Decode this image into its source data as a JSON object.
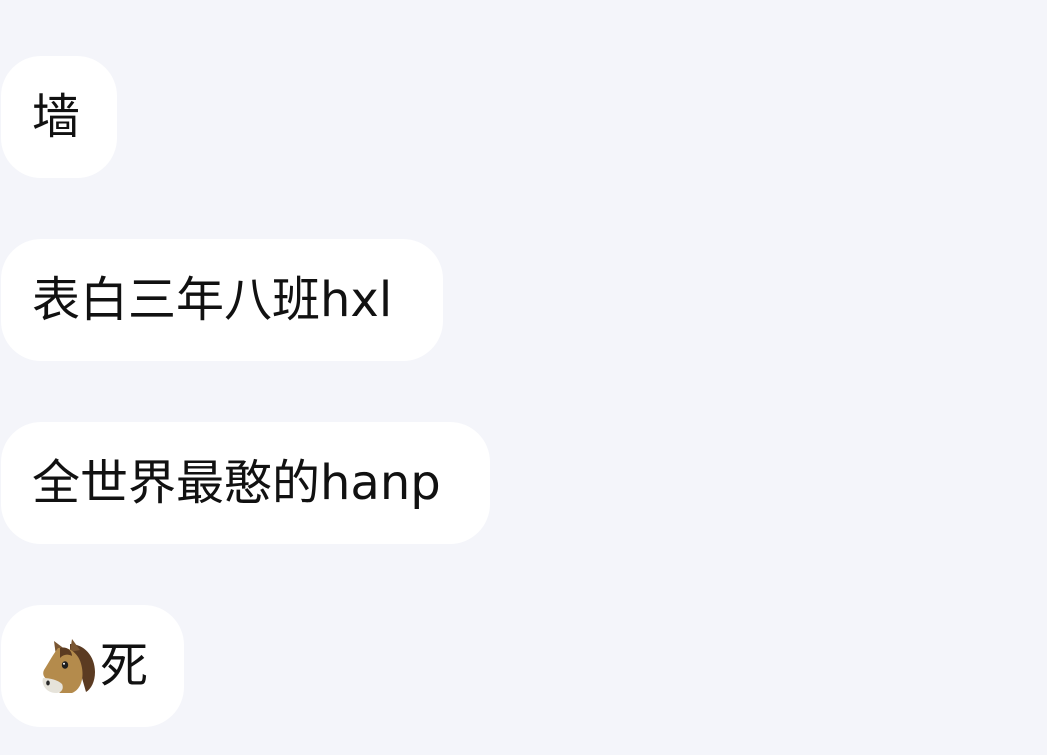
{
  "messages": [
    {
      "text": "墙"
    },
    {
      "text": "表白三年八班hxl"
    },
    {
      "text": "全世界最憨的hanp"
    },
    {
      "emoji": "horse-face-icon",
      "text": "死"
    }
  ]
}
